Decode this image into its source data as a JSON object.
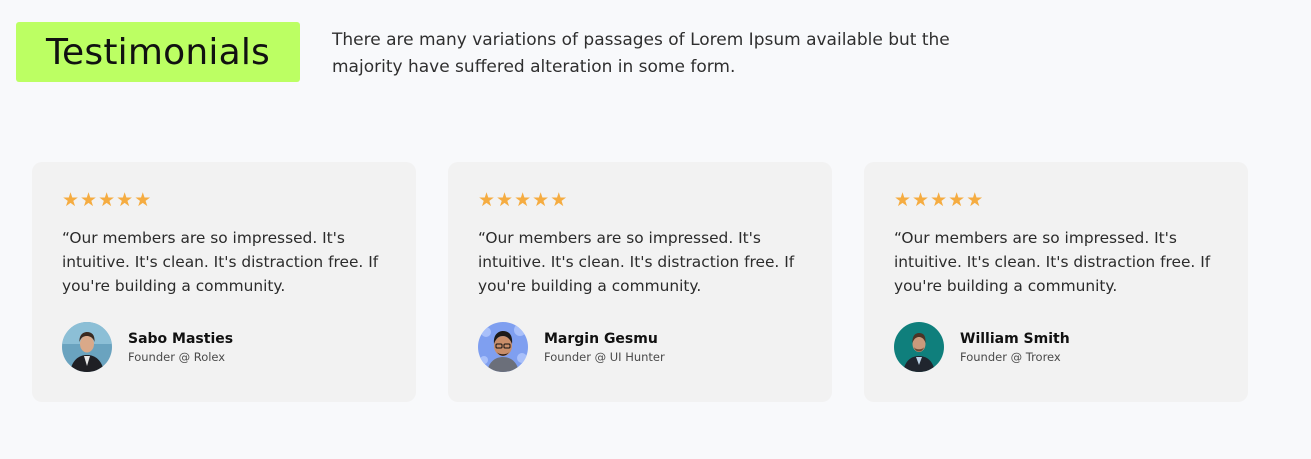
{
  "header": {
    "title": "Testimonials",
    "intro": "There are many variations of passages of Lorem Ipsum available but the majority have suffered alteration in some form."
  },
  "colors": {
    "accent": "#bcff63",
    "star": "#f5ac41",
    "card_bg": "#f2f2f2",
    "page_bg": "#f8f9fb"
  },
  "testimonials": [
    {
      "rating": 5,
      "quote": "“Our members are so impressed. It's intuitive. It's clean. It's distraction free. If you're building a community.",
      "name": "Sabo Masties",
      "role": "Founder @ Rolex",
      "avatar_icon": "person-portrait"
    },
    {
      "rating": 5,
      "quote": "“Our members are so impressed. It's intuitive. It's clean. It's distraction free. If you're building a community.",
      "name": "Margin Gesmu",
      "role": "Founder @ UI Hunter",
      "avatar_icon": "person-portrait"
    },
    {
      "rating": 5,
      "quote": "“Our members are so impressed. It's intuitive. It's clean. It's distraction free. If you're building a community.",
      "name": "William Smith",
      "role": "Founder @ Trorex",
      "avatar_icon": "person-portrait"
    }
  ]
}
